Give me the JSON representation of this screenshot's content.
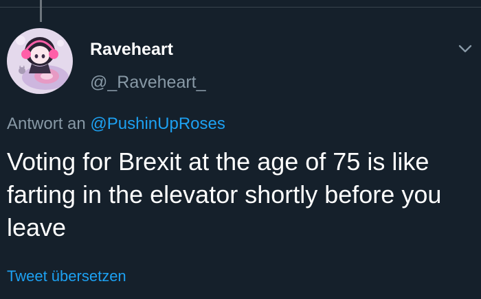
{
  "tweet": {
    "display_name": "Raveheart",
    "handle": "@_Raveheart_",
    "reply_prefix": "Antwort an",
    "reply_to": "@PushinUpRoses",
    "text": "Voting for Brexit at the age of 75 is like farting in the elevator shortly before you leave",
    "translate_label": "Tweet übersetzen"
  },
  "icons": {
    "avatar": "anime-girl-avatar",
    "menu": "chevron-down-icon"
  },
  "colors": {
    "background": "#15202b",
    "primary_text": "#ffffff",
    "secondary_text": "#8899a6",
    "accent": "#1da1f2",
    "divider": "#38444d"
  }
}
